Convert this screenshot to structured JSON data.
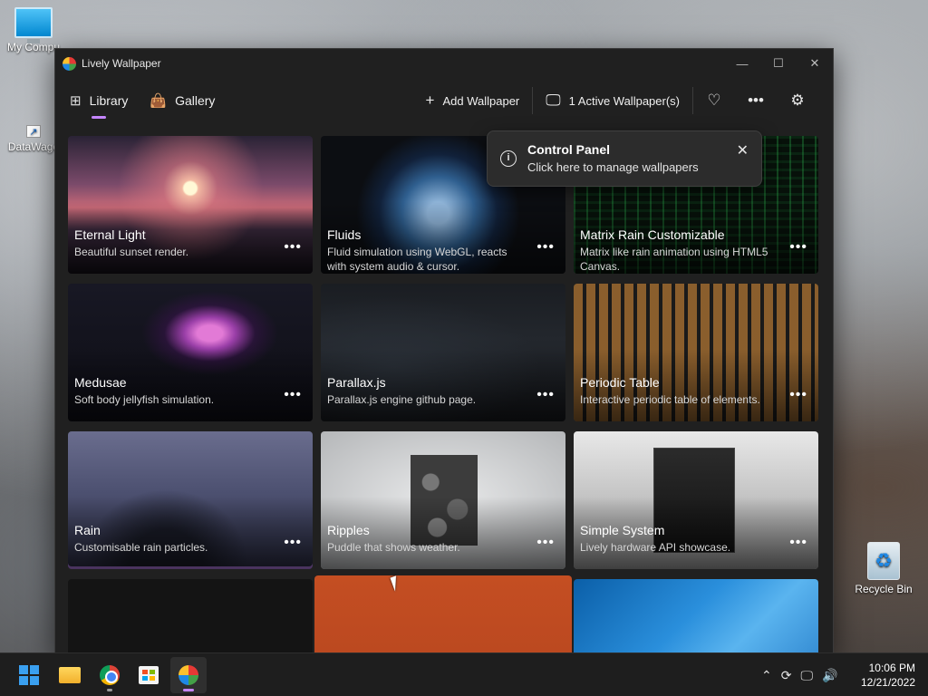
{
  "desktop": {
    "icons": [
      {
        "label": "My Compu"
      },
      {
        "label": "DataWago"
      },
      {
        "label": "Recycle Bin"
      }
    ]
  },
  "window": {
    "title": "Lively Wallpaper",
    "controls": {
      "minimize": "—",
      "maximize": "☐",
      "close": "✕"
    }
  },
  "nav": {
    "library": "Library",
    "gallery": "Gallery",
    "add_wallpaper": "Add Wallpaper",
    "active_wallpapers": "1 Active Wallpaper(s)"
  },
  "tip": {
    "title": "Control Panel",
    "subtitle": "Click here to manage wallpapers"
  },
  "wallpapers": [
    {
      "name": "Eternal Light",
      "desc": "Beautiful sunset render."
    },
    {
      "name": "Fluids",
      "desc": "Fluid simulation using WebGL, reacts with system audio & cursor."
    },
    {
      "name": "Matrix Rain Customizable",
      "desc": "Matrix like rain animation using HTML5 Canvas."
    },
    {
      "name": "Medusae",
      "desc": "Soft body jellyfish simulation."
    },
    {
      "name": "Parallax.js",
      "desc": "Parallax.js engine github page."
    },
    {
      "name": "Periodic Table",
      "desc": "Interactive periodic table of elements."
    },
    {
      "name": "Rain",
      "desc": "Customisable rain particles."
    },
    {
      "name": "Ripples",
      "desc": "Puddle that shows weather."
    },
    {
      "name": "Simple System",
      "desc": "Lively hardware API showcase."
    }
  ],
  "taskbar": {
    "time": "10:06 PM",
    "date": "12/21/2022"
  },
  "colors": {
    "accent": "#c586ff",
    "window_bg": "#202020"
  }
}
